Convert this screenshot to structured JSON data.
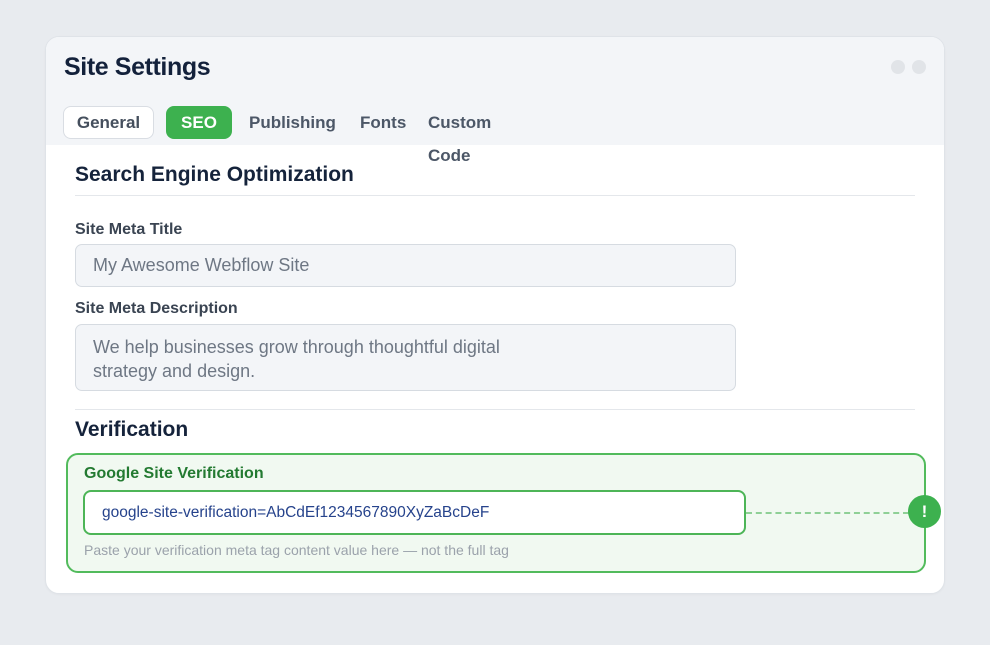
{
  "window": {
    "title": "Site Settings"
  },
  "tabs": [
    {
      "label": "General"
    },
    {
      "label": "SEO"
    },
    {
      "label": "Publishing"
    },
    {
      "label": "Fonts"
    },
    {
      "label": "Custom Code"
    }
  ],
  "active_tab": "SEO",
  "seo": {
    "heading": "Search Engine Optimization",
    "meta_title": {
      "label": "Site Meta Title",
      "value": "My Awesome Webflow Site"
    },
    "meta_description": {
      "label": "Site Meta Description",
      "line1": "We help businesses grow through thoughtful digital",
      "line2": "strategy and design."
    }
  },
  "verification": {
    "heading": "Verification",
    "google": {
      "label": "Google Site Verification",
      "value": "google-site-verification=AbCdEf1234567890XyZaBcDeF",
      "hint": "Paste your verification meta tag content value here — not the full tag",
      "status_symbol": "!"
    }
  },
  "colors": {
    "accent": "#3db14f",
    "highlight_border": "#52bb5c",
    "highlight_background": "#f1f9f1"
  }
}
